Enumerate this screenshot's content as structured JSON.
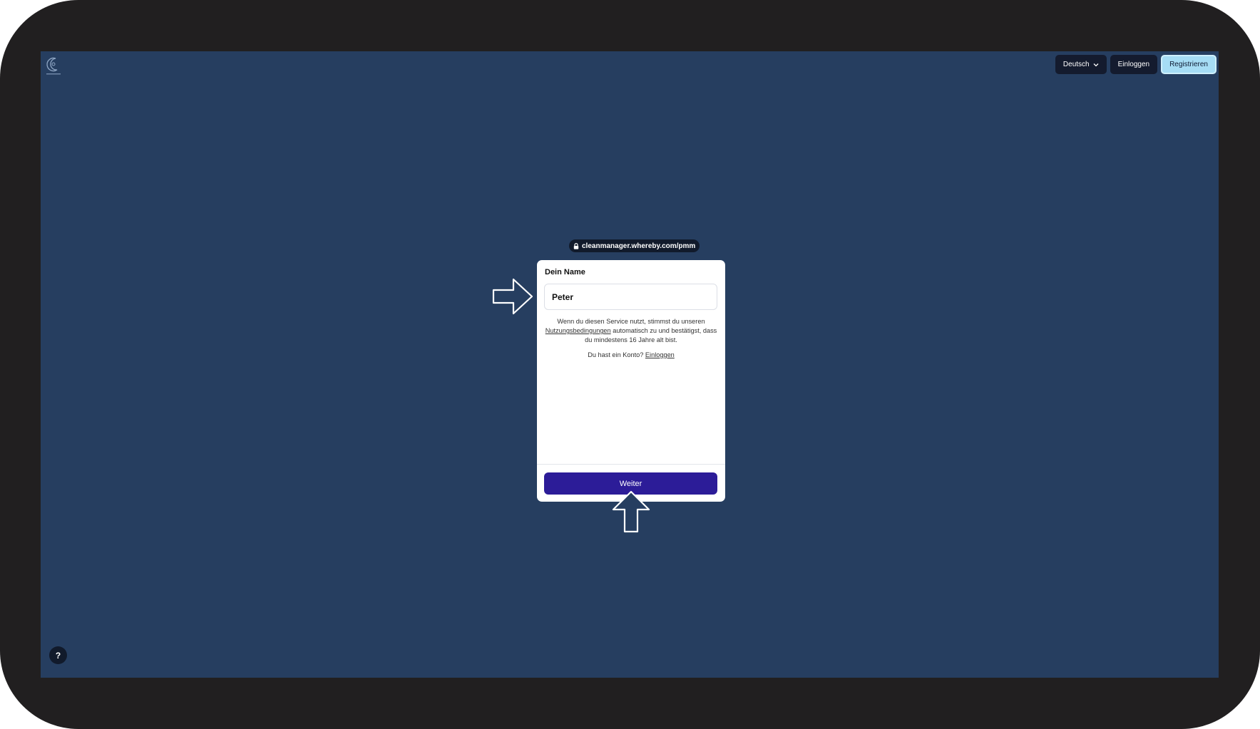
{
  "header": {
    "logo_icon": "crescent-logo-icon",
    "language_label": "Deutsch",
    "login_label": "Einloggen",
    "register_label": "Registrieren"
  },
  "url_bar": {
    "url": "cleanmanager.whereby.com/pmm",
    "icon": "lock-icon"
  },
  "form": {
    "name_label": "Dein Name",
    "name_value": "Peter",
    "terms_before": "Wenn du diesen Service nutzt, stimmst du unseren",
    "terms_link": "Nutzungsbedingungen",
    "terms_after": "automatisch zu und bestätigst, dass du mindestens 16 Jahre alt bist.",
    "account_prompt": "Du hast ein Konto?",
    "account_login_link": "Einloggen",
    "continue_label": "Weiter"
  },
  "help": {
    "label": "?"
  },
  "colors": {
    "frame": "#211f20",
    "background": "#263e60",
    "primary_button": "#2c1c98",
    "register_button": "#a6ddf5",
    "nav_button": "#141b2e"
  }
}
